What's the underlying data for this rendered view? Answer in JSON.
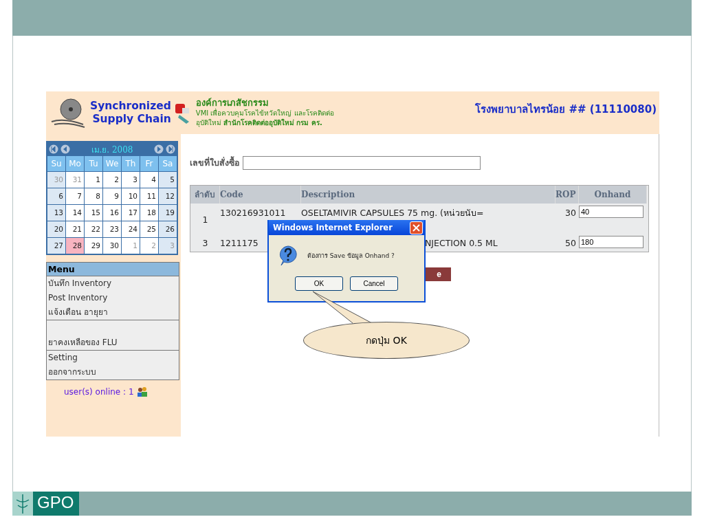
{
  "header": {
    "title_lines": [
      "Synchronized",
      "Supply Chain"
    ],
    "org": {
      "name": "องค์การเภสัชกรรม",
      "line1": "VMI เพื่อควบคุมโรคไข้หวัดใหญ่ และโรคติดต่อ",
      "line2": "อุบัติใหม่ **สำนักโรคติดต่ออุบัติใหม่ กรม คร.**"
    },
    "hospital": "โรงพยาบาลไทรน้อย ## (11110080)"
  },
  "calendar": {
    "month": "เม.ย. 2008",
    "weekdays": [
      "Su",
      "Mo",
      "Tu",
      "We",
      "Th",
      "Fr",
      "Sa"
    ],
    "weeks": [
      [
        {
          "label": "30",
          "other_month": true,
          "selected": false
        },
        {
          "label": "31",
          "other_month": true,
          "selected": false
        },
        {
          "label": "1",
          "other_month": false,
          "selected": false
        },
        {
          "label": "2",
          "other_month": false,
          "selected": false
        },
        {
          "label": "3",
          "other_month": false,
          "selected": false
        },
        {
          "label": "4",
          "other_month": false,
          "selected": false
        },
        {
          "label": "5",
          "other_month": false,
          "selected": false
        }
      ],
      [
        {
          "label": "6",
          "other_month": false,
          "selected": false
        },
        {
          "label": "7",
          "other_month": false,
          "selected": false
        },
        {
          "label": "8",
          "other_month": false,
          "selected": false
        },
        {
          "label": "9",
          "other_month": false,
          "selected": false
        },
        {
          "label": "10",
          "other_month": false,
          "selected": false
        },
        {
          "label": "11",
          "other_month": false,
          "selected": false
        },
        {
          "label": "12",
          "other_month": false,
          "selected": false
        }
      ],
      [
        {
          "label": "13",
          "other_month": false,
          "selected": false
        },
        {
          "label": "14",
          "other_month": false,
          "selected": false
        },
        {
          "label": "15",
          "other_month": false,
          "selected": false
        },
        {
          "label": "16",
          "other_month": false,
          "selected": false
        },
        {
          "label": "17",
          "other_month": false,
          "selected": false
        },
        {
          "label": "18",
          "other_month": false,
          "selected": false
        },
        {
          "label": "19",
          "other_month": false,
          "selected": false
        }
      ],
      [
        {
          "label": "20",
          "other_month": false,
          "selected": false
        },
        {
          "label": "21",
          "other_month": false,
          "selected": false
        },
        {
          "label": "22",
          "other_month": false,
          "selected": false
        },
        {
          "label": "23",
          "other_month": false,
          "selected": false
        },
        {
          "label": "24",
          "other_month": false,
          "selected": false
        },
        {
          "label": "25",
          "other_month": false,
          "selected": false
        },
        {
          "label": "26",
          "other_month": false,
          "selected": false
        }
      ],
      [
        {
          "label": "27",
          "other_month": false,
          "selected": false
        },
        {
          "label": "28",
          "other_month": false,
          "selected": true
        },
        {
          "label": "29",
          "other_month": false,
          "selected": false
        },
        {
          "label": "30",
          "other_month": false,
          "selected": false
        },
        {
          "label": "1",
          "other_month": true,
          "selected": false
        },
        {
          "label": "2",
          "other_month": true,
          "selected": false
        },
        {
          "label": "3",
          "other_month": true,
          "selected": false
        }
      ]
    ]
  },
  "menu": {
    "title": "Menu",
    "groups": [
      {
        "kind": "plain",
        "items": [
          "บันทึก Inventory",
          "Post Inventory",
          "แจ้งเตือน อายุยา"
        ]
      },
      {
        "kind": "spaced",
        "items": [
          "ยาคงเหลือของ FLU"
        ]
      },
      {
        "kind": "plain",
        "items": [
          "Setting",
          "ออกจากระบบ"
        ]
      }
    ]
  },
  "users_online": "user(s) online : 1",
  "order": {
    "label": "เลขที่ใบสั่งซื้อ"
  },
  "table": {
    "columns": [
      "ลำดับ",
      "Code",
      "Description",
      "ROP",
      "Onhand"
    ],
    "rows": [
      {
        "no": "1",
        "code": "130216931011",
        "description": "OSELTAMIVIR CAPSULES 75 mg. (หน่วยนับ=",
        "rop": "30",
        "onhand": "40",
        "covered": false
      },
      {
        "no": "3",
        "code": "1211175",
        "description": "NJECTION 0.5 ML",
        "rop": "50",
        "onhand": "180",
        "covered": true
      }
    ]
  },
  "save_button": "e",
  "dialog": {
    "title": "Windows Internet Explorer",
    "message": "ต้องการ Save ข้อมูล Onhand ?",
    "buttons": [
      "OK",
      "Cancel"
    ]
  },
  "callout": "กดปุ่ม OK",
  "logo": "GPO"
}
